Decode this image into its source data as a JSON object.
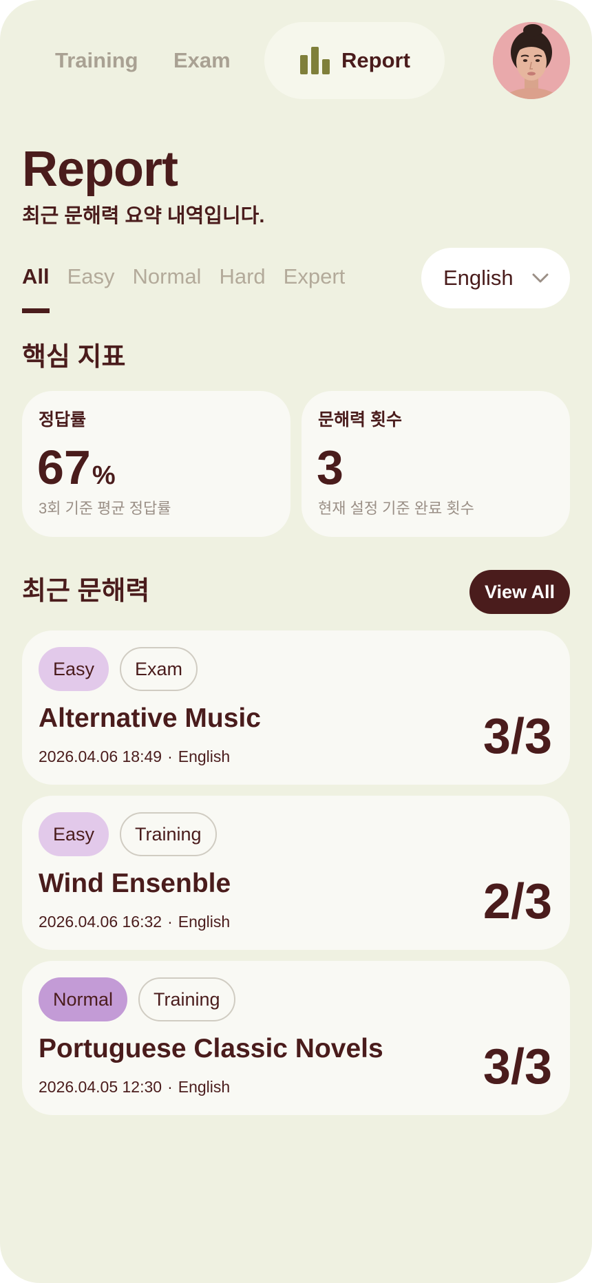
{
  "nav": {
    "training": "Training",
    "exam": "Exam",
    "report": "Report",
    "active_icon": "bar-chart-icon",
    "icon_color": "#7f7f3a"
  },
  "header": {
    "title": "Report",
    "subtitle": "최근 문해력 요약 내역입니다."
  },
  "filters": {
    "tabs": [
      "All",
      "Easy",
      "Normal",
      "Hard",
      "Expert"
    ],
    "active": "All",
    "language": "English"
  },
  "metrics": {
    "title": "핵심 지표",
    "accuracy": {
      "label": "정답률",
      "value": "67",
      "unit": "%",
      "caption": "3회 기준 평균 정답률"
    },
    "count": {
      "label": "문해력 횟수",
      "value": "3",
      "caption": "현재 설정 기준 완료 횟수"
    }
  },
  "recent": {
    "title": "최근 문해력",
    "view_all": "View All",
    "items": [
      {
        "level": "Easy",
        "mode": "Exam",
        "title": "Alternative Music",
        "datetime": "2026.04.06 18:49",
        "language": "English",
        "score": "3/3"
      },
      {
        "level": "Easy",
        "mode": "Training",
        "title": "Wind Ensenble",
        "datetime": "2026.04.06 16:32",
        "language": "English",
        "score": "2/3"
      },
      {
        "level": "Normal",
        "mode": "Training",
        "title": "Portuguese Classic Novels",
        "datetime": "2026.04.05 12:30",
        "language": "English",
        "score": "3/3"
      }
    ]
  },
  "colors": {
    "background": "#eff1e1",
    "primary": "#4a1c1c",
    "card": "#f9f9f4",
    "tag_easy": "#e2c9ea",
    "tag_normal": "#c39bd6",
    "muted": "#b3aa9a"
  }
}
